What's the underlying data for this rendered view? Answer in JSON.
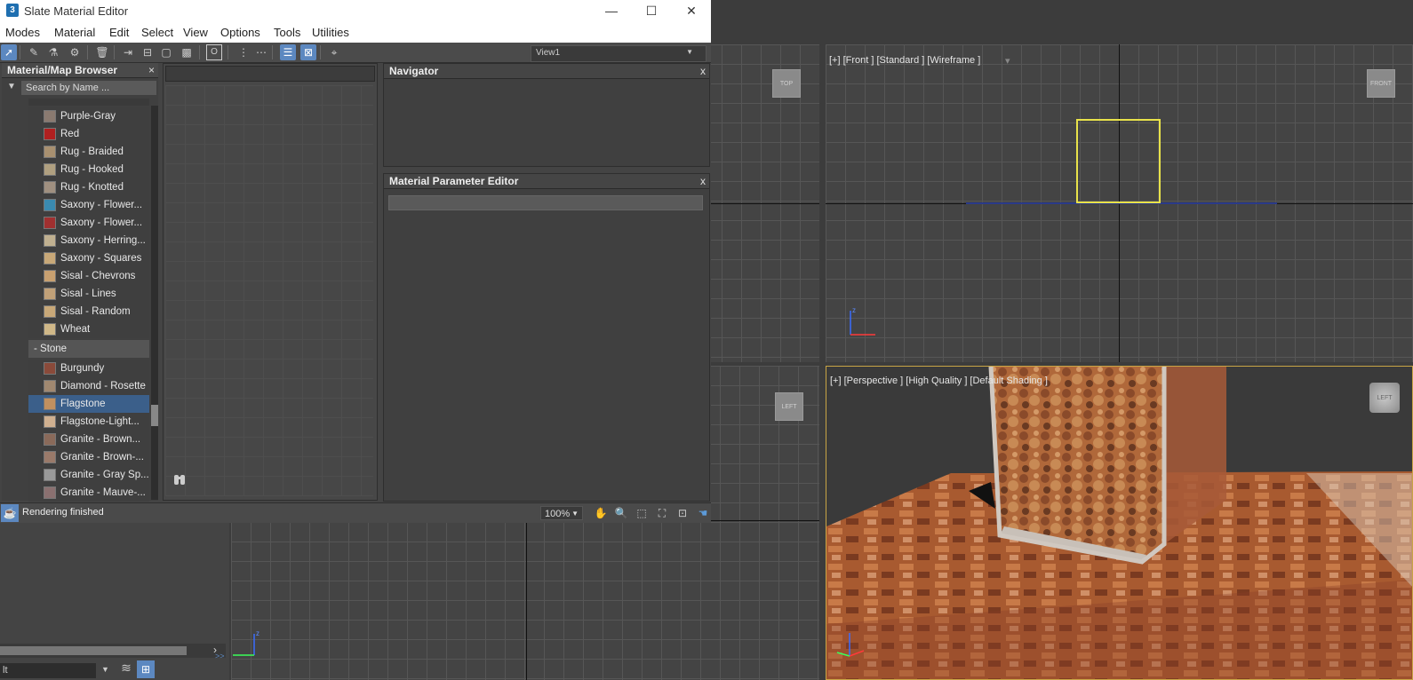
{
  "window": {
    "title": "Slate Material Editor",
    "app_icon": "3",
    "minimize": "—",
    "maximize": "☐",
    "close": "✕"
  },
  "menu": [
    "Modes",
    "Material",
    "Edit",
    "Select",
    "View",
    "Options",
    "Tools",
    "Utilities"
  ],
  "toolbar": {
    "view_selector": "View1"
  },
  "browser": {
    "title": "Material/Map Browser",
    "search_placeholder": "Search by Name ...",
    "items_before": [
      {
        "label": "Purple-Gray",
        "color": "#8a7a70"
      },
      {
        "label": "Red",
        "color": "#b02020"
      },
      {
        "label": "Rug - Braided",
        "color": "#a89070"
      },
      {
        "label": "Rug - Hooked",
        "color": "#b0a080"
      },
      {
        "label": "Rug - Knotted",
        "color": "#a09080"
      },
      {
        "label": "Saxony - Flower...",
        "color": "#3a8ab0"
      },
      {
        "label": "Saxony - Flower...",
        "color": "#a03030"
      },
      {
        "label": "Saxony - Herring...",
        "color": "#c0b090"
      },
      {
        "label": "Saxony - Squares",
        "color": "#c8a878"
      },
      {
        "label": "Sisal - Chevrons",
        "color": "#c8a070"
      },
      {
        "label": "Sisal - Lines",
        "color": "#c0a078"
      },
      {
        "label": "Sisal - Random",
        "color": "#c8a878"
      },
      {
        "label": "Wheat",
        "color": "#d0b888"
      }
    ],
    "group": "-  Stone",
    "items_after": [
      {
        "label": "Burgundy",
        "color": "#8a4a3a"
      },
      {
        "label": "Diamond - Rosette",
        "color": "#a08870"
      },
      {
        "label": "Flagstone",
        "color": "#c09060"
      },
      {
        "label": "Flagstone-Light...",
        "color": "#d0b090"
      },
      {
        "label": "Granite - Brown...",
        "color": "#8a6a5a"
      },
      {
        "label": "Granite - Brown-...",
        "color": "#9a7a6a"
      },
      {
        "label": "Granite - Gray Sp...",
        "color": "#9a9a9a"
      },
      {
        "label": "Granite - Mauve-...",
        "color": "#8a7070"
      }
    ],
    "selected": "Flagstone"
  },
  "navigator": {
    "title": "Navigator",
    "close": "x"
  },
  "mpe": {
    "title": "Material Parameter Editor",
    "close": "x"
  },
  "status": {
    "text": "Rendering finished",
    "zoom": "100%"
  },
  "viewports": {
    "top_cube": "TOP",
    "front_label": "[+] [Front ] [Standard ] [Wireframe ]",
    "front_cube": "FRONT",
    "left_cube": "LEFT",
    "persp_label": "[+] [Perspective ] [High Quality ] [Default Shading ]",
    "persp_cube": "LEFT"
  },
  "bottom_left": {
    "input_value": "lt",
    "collapse": ">>"
  }
}
